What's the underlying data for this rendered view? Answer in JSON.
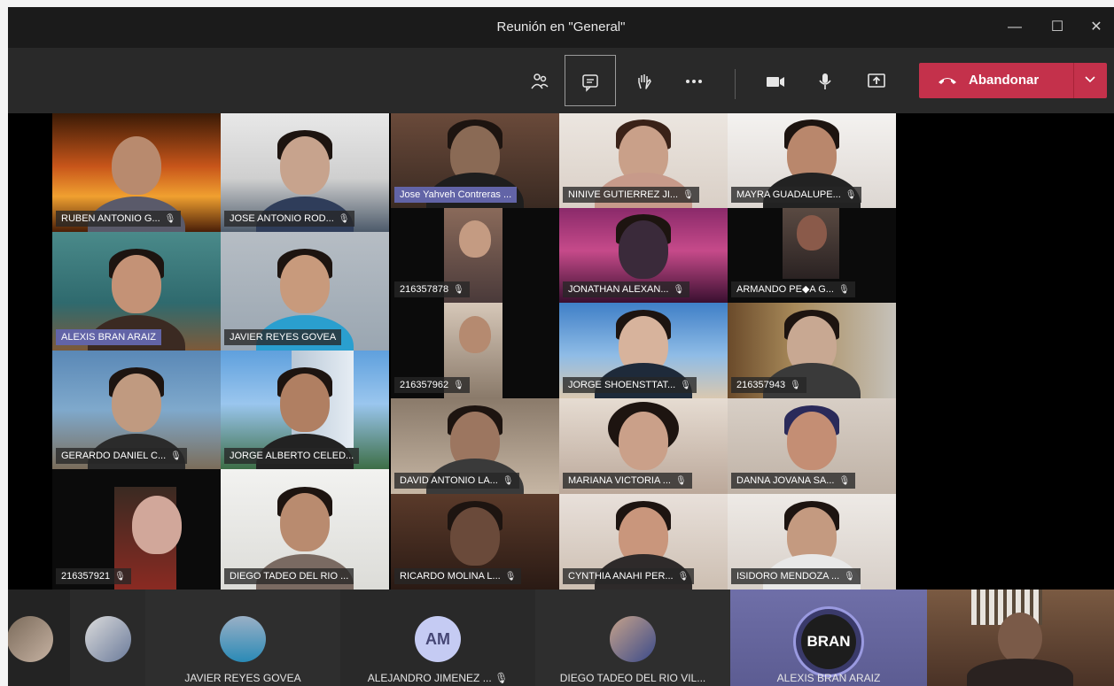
{
  "window": {
    "title": "Reunión en \"General\"",
    "minimize": "—",
    "maximize": "☐",
    "close": "✕"
  },
  "toolbar": {
    "leave_label": "Abandonar",
    "icons": [
      "participants-icon",
      "chat-icon",
      "raise-hand-icon",
      "more-icon",
      "camera-icon",
      "mic-icon",
      "share-icon"
    ]
  },
  "tiles": [
    {
      "name": "RUBEN ANTONIO G...",
      "mic": "🎙"
    },
    {
      "name": "JOSE ANTONIO ROD...",
      "mic": "🎙"
    },
    {
      "name": "Jose Yahveh Contreras ...",
      "mic": ""
    },
    {
      "name": "NINIVE GUTIERREZ JI...",
      "mic": "🎙"
    },
    {
      "name": "MAYRA GUADALUPE...",
      "mic": "🎙"
    },
    {
      "name": "ALEXIS BRAN ARAIZ",
      "mic": ""
    },
    {
      "name": "JAVIER REYES GOVEA",
      "mic": ""
    },
    {
      "name": "21635787​8",
      "mic": "🎙"
    },
    {
      "name": "JONATHAN ALEXAN...",
      "mic": "🎙"
    },
    {
      "name": "ARMANDO PE◆A G...",
      "mic": "🎙"
    },
    {
      "name": "21635796​2",
      "mic": "🎙"
    },
    {
      "name": "JORGE SHOENSTTAT...",
      "mic": "🎙"
    },
    {
      "name": "21635794​3",
      "mic": "🎙"
    },
    {
      "name": "GERARDO DANIEL C...",
      "mic": "🎙"
    },
    {
      "name": "JORGE ALBERTO CELED...",
      "mic": ""
    },
    {
      "name": "DAVID ANTONIO LA...",
      "mic": "🎙"
    },
    {
      "name": "MARIANA VICTORIA ...",
      "mic": "🎙"
    },
    {
      "name": "DANNA JOVANA SA...",
      "mic": "🎙"
    },
    {
      "name": "21635792​1",
      "mic": "🎙"
    },
    {
      "name": "DIEGO TADEO DEL RIO ...",
      "mic": ""
    },
    {
      "name": "RICARDO MOLINA L...",
      "mic": "🎙"
    },
    {
      "name": "CYNTHIA ANAHI PER...",
      "mic": "🎙"
    },
    {
      "name": "ISIDORO MENDOZA ...",
      "mic": "🎙"
    }
  ],
  "strip": [
    {
      "name": "",
      "initials": ""
    },
    {
      "name": "",
      "initials": ""
    },
    {
      "name": "JAVIER REYES GOVEA",
      "initials": ""
    },
    {
      "name": "ALEJANDRO JIMENEZ ...",
      "initials": "AM"
    },
    {
      "name": "DIEGO TADEO DEL RIO VIL...",
      "initials": ""
    },
    {
      "name": "ALEXIS BRAN ARAIZ",
      "initials": "BRAN"
    },
    {
      "name": "",
      "initials": ""
    }
  ],
  "colors": {
    "leave": "#c4314b",
    "highlight_name": "#6264a7",
    "toolbar": "#292929",
    "titlebar": "#1b1b1b"
  }
}
